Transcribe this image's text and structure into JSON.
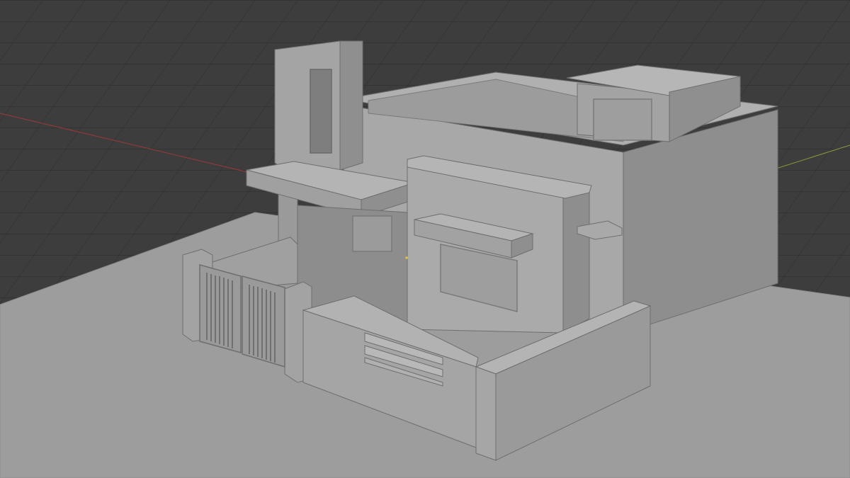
{
  "viewport": {
    "background_color": "#3d3d3d",
    "grid_color": "#2a2a2a",
    "x_axis_color": "#8f3a3a",
    "y_axis_color": "#8c9a3a"
  },
  "scene": {
    "ground_color": "#9d9d9d",
    "wall_light": "#a7a7a7",
    "wall_mid": "#9a9a9a",
    "wall_dark": "#8b8b8b",
    "edge_color": "#6e6e6e",
    "top_color": "#b3b3b3"
  }
}
